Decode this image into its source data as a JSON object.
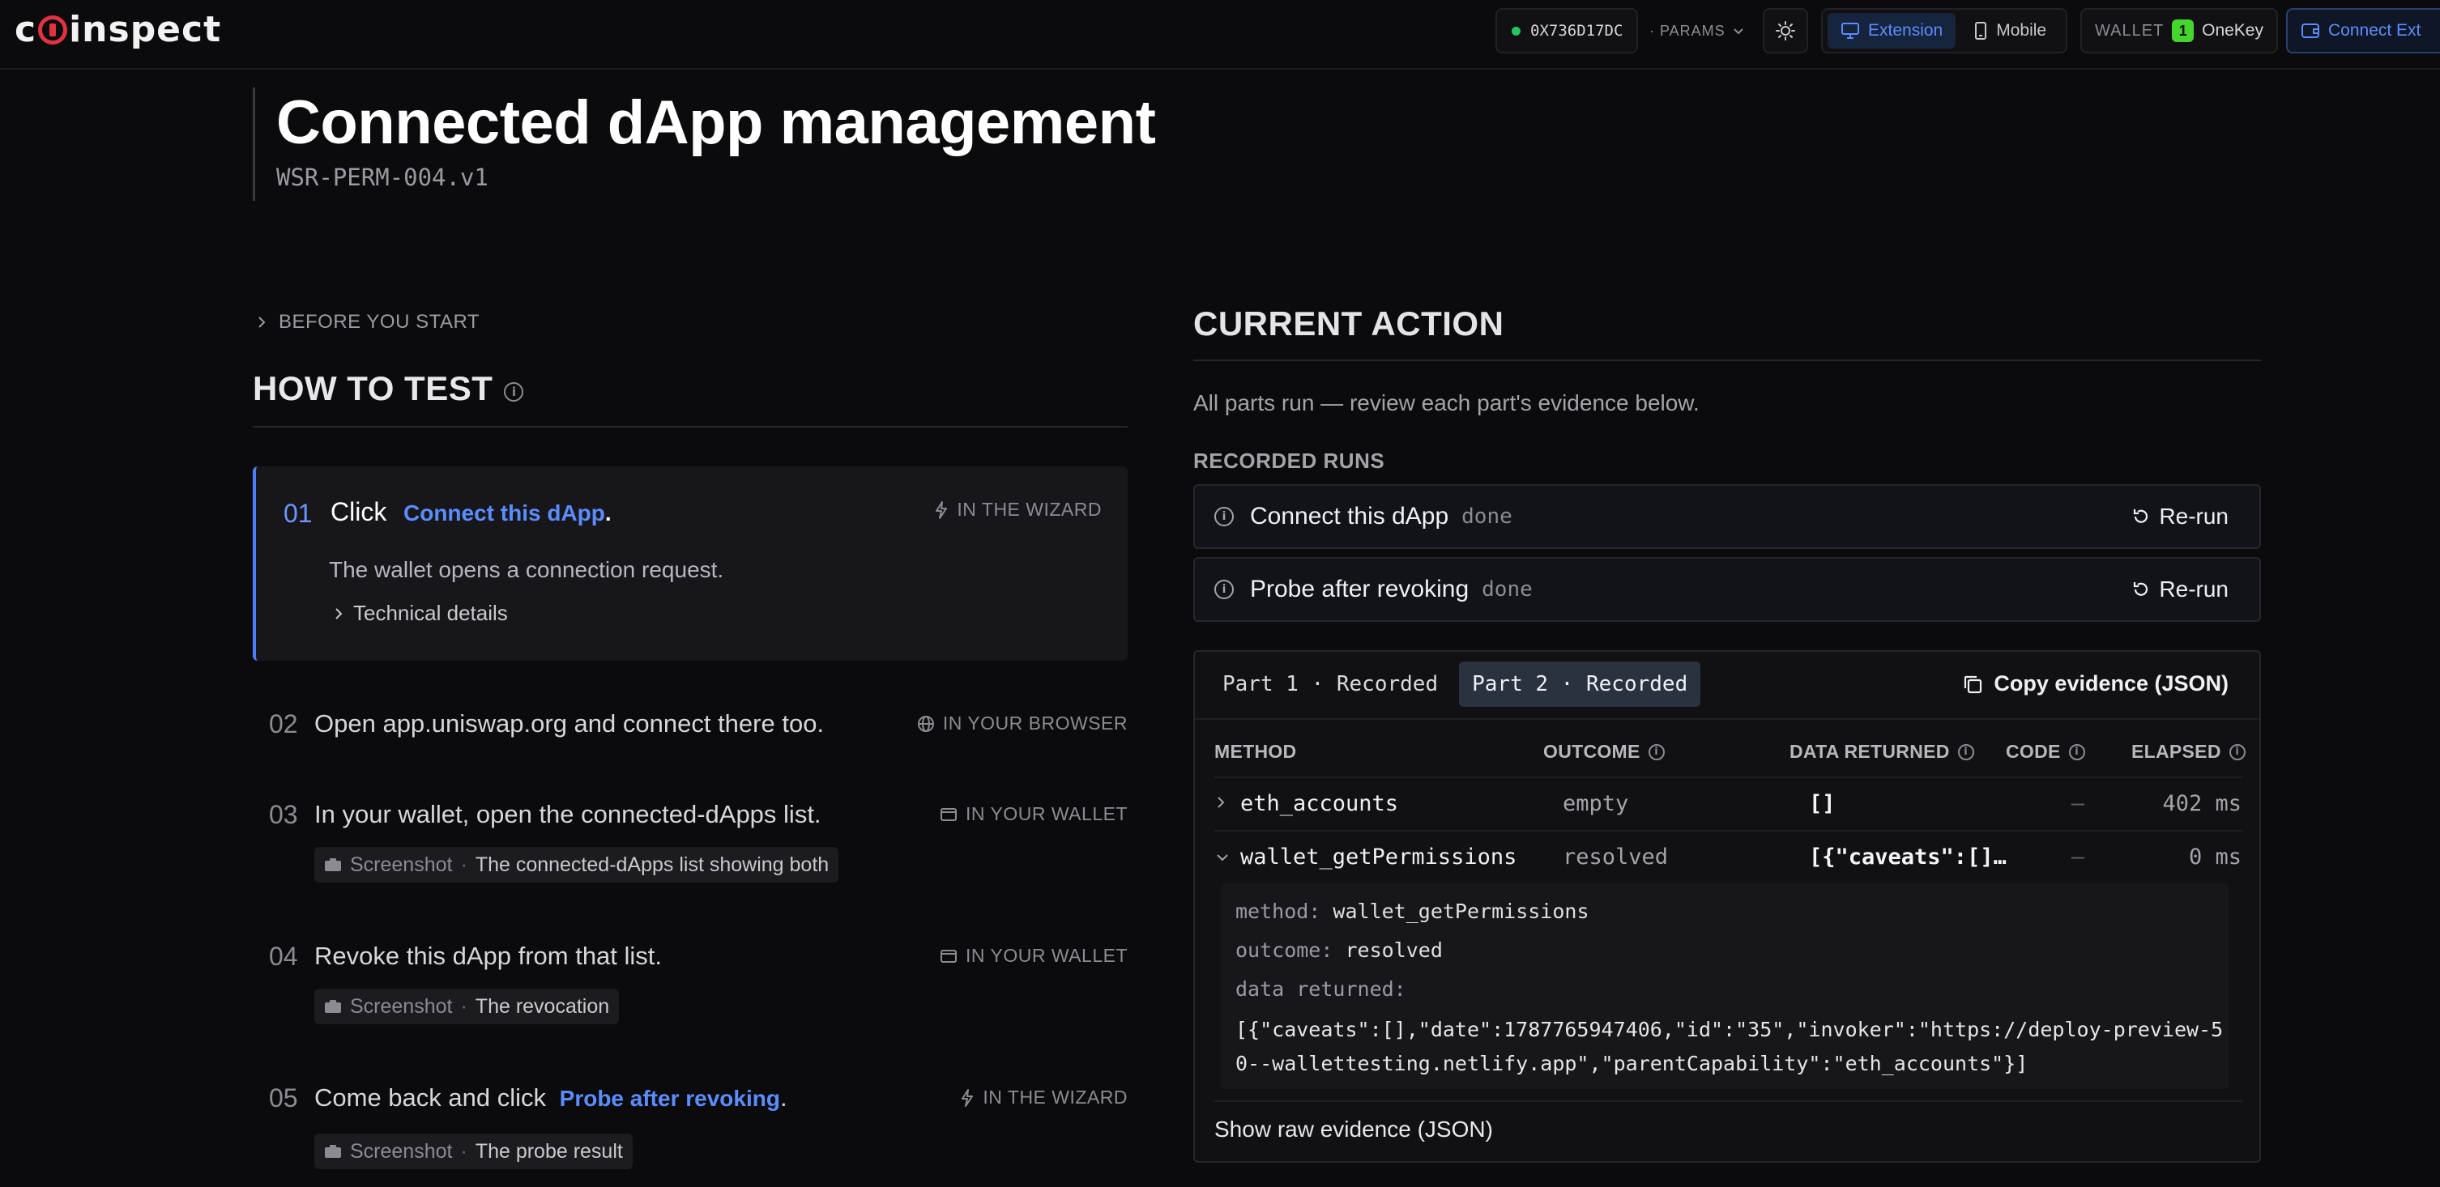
{
  "app": {
    "logo": "coinspect",
    "address": "0X736D17DC",
    "params_label": "· PARAMS",
    "modes": [
      "Extension",
      "Mobile"
    ],
    "active_mode": "Extension",
    "wallet_label": "WALLET",
    "wallet_name": "OneKey",
    "connect_label": "Connect Ext",
    "accent": "#5b8dff"
  },
  "header": {
    "title": "Connected dApp management",
    "test_id": "WSR-PERM-004.v1"
  },
  "left": {
    "before_label": "BEFORE YOU START",
    "how_to_title": "HOW TO TEST",
    "steps": [
      {
        "num": "01",
        "verb": "Click",
        "link": "Connect this dApp",
        "suffix": ".",
        "where": "IN THE WIZARD",
        "desc": "The wallet opens a connection request.",
        "tech": "Technical details"
      },
      {
        "num": "02",
        "text": "Open app.uniswap.org and connect there too.",
        "where": "IN YOUR BROWSER"
      },
      {
        "num": "03",
        "text": "In your wallet, open the connected-dApps list.",
        "where": "IN YOUR WALLET",
        "shot_label": "Screenshot",
        "shot_sep": "·",
        "shot_value": "The connected-dApps list showing both"
      },
      {
        "num": "04",
        "text": "Revoke this dApp from that list.",
        "where": "IN YOUR WALLET",
        "shot_label": "Screenshot",
        "shot_sep": "·",
        "shot_value": "The revocation"
      },
      {
        "num": "05",
        "text": "Come back and click",
        "link": "Probe after revoking",
        "suffix": ".",
        "where": "IN THE WIZARD",
        "shot_label": "Screenshot",
        "shot_sep": "·",
        "shot_value": "The probe result"
      }
    ]
  },
  "right": {
    "current_action_title": "CURRENT ACTION",
    "current_action_sub": "All parts run — review each part's evidence below.",
    "recorded_runs_label": "RECORDED RUNS",
    "runs": [
      {
        "name": "Connect this dApp",
        "status": "done",
        "action": "Re-run"
      },
      {
        "name": "Probe after revoking",
        "status": "done",
        "action": "Re-run"
      }
    ],
    "tabs": [
      "Part 1 · Recorded",
      "Part 2 · Recorded"
    ],
    "active_tab": "Part 2 · Recorded",
    "copy_label": "Copy evidence (JSON)",
    "columns": [
      "METHOD",
      "OUTCOME",
      "DATA RETURNED",
      "CODE",
      "ELAPSED"
    ],
    "rows": [
      {
        "method": "eth_accounts",
        "outcome": "empty",
        "data": "[]",
        "code": "—",
        "elapsed": "402 ms",
        "expanded": "false"
      },
      {
        "method": "wallet_getPermissions",
        "outcome": "resolved",
        "data": "[{\"caveats\":[]…",
        "code": "—",
        "elapsed": "0 ms",
        "expanded": "true"
      }
    ],
    "detail": {
      "method_key": "method:",
      "method_val": "wallet_getPermissions",
      "outcome_key": "outcome:",
      "outcome_val": "resolved",
      "data_key": "data returned:",
      "data_val": "[{\"caveats\":[],\"date\":1787765947406,\"id\":\"35\",\"invoker\":\"https://deploy-preview-50--wallettesting.netlify.app\",\"parentCapability\":\"eth_accounts\"}]"
    },
    "show_raw_label": "Show raw evidence (JSON)"
  }
}
